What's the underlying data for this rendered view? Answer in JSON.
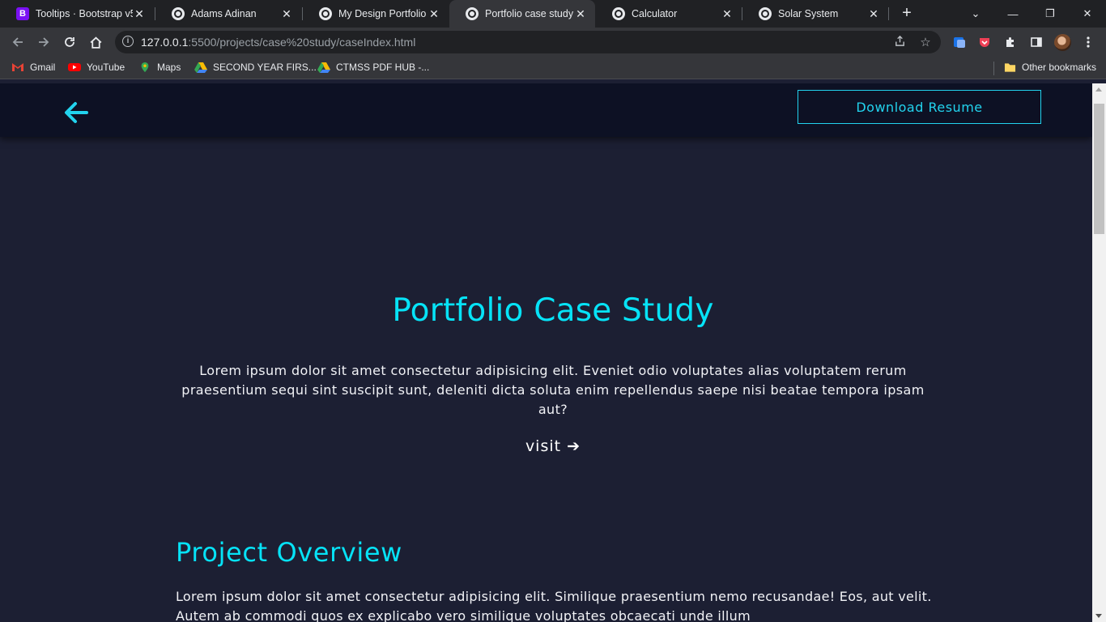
{
  "browser": {
    "tabs": [
      {
        "title": "Tooltips · Bootstrap v5.",
        "icon": "bootstrap-icon",
        "icon_letter": "B"
      },
      {
        "title": "Adams Adinan",
        "icon": "globe-icon"
      },
      {
        "title": "My Design Portfolio",
        "icon": "globe-icon"
      },
      {
        "title": "Portfolio case study",
        "icon": "globe-icon",
        "active": true
      },
      {
        "title": "Calculator",
        "icon": "globe-icon"
      },
      {
        "title": "Solar System",
        "icon": "globe-icon"
      }
    ],
    "tab_close_glyph": "✕",
    "new_tab_glyph": "+",
    "window_controls": {
      "minimize": "—",
      "restore": "❐",
      "close": "✕",
      "tab_search": "⌄"
    },
    "url_host": "127.0.0.1",
    "url_rest": ":5500/projects/case%20study/caseIndex.html",
    "bookmarks": [
      {
        "label": "Gmail",
        "icon": "gmail-icon",
        "color": "#ea4335"
      },
      {
        "label": "YouTube",
        "icon": "youtube-icon",
        "color": "#ff0000"
      },
      {
        "label": "Maps",
        "icon": "maps-icon",
        "color": "#34a853"
      },
      {
        "label": "SECOND YEAR FIRS...",
        "icon": "drive-icon",
        "color": "#fbbc04"
      },
      {
        "label": "CTMSS PDF HUB -...",
        "icon": "drive-icon",
        "color": "#fbbc04"
      }
    ],
    "other_bookmarks": "Other bookmarks"
  },
  "header": {
    "resume_label": "Download Resume",
    "accent": "#22d3ee"
  },
  "hero": {
    "title": "Portfolio Case Study",
    "text": "Lorem ipsum dolor sit amet consectetur adipisicing elit. Eveniet odio voluptates alias voluptatem rerum praesentium sequi sint suscipit sunt, deleniti dicta soluta enim repellendus saepe nisi beatae tempora ipsam aut?",
    "visit_label": "visit ➔"
  },
  "overview": {
    "title": "Project Overview",
    "text": "Lorem ipsum dolor sit amet consectetur adipisicing elit. Similique praesentium nemo recusandae! Eos, aut velit. Autem ab commodi quos ex explicabo vero similique voluptates obcaecati unde illum"
  },
  "colors": {
    "page_bg": "#1c1f33",
    "header_bg": "#0d1124",
    "title_cyan": "#06e3f7"
  }
}
